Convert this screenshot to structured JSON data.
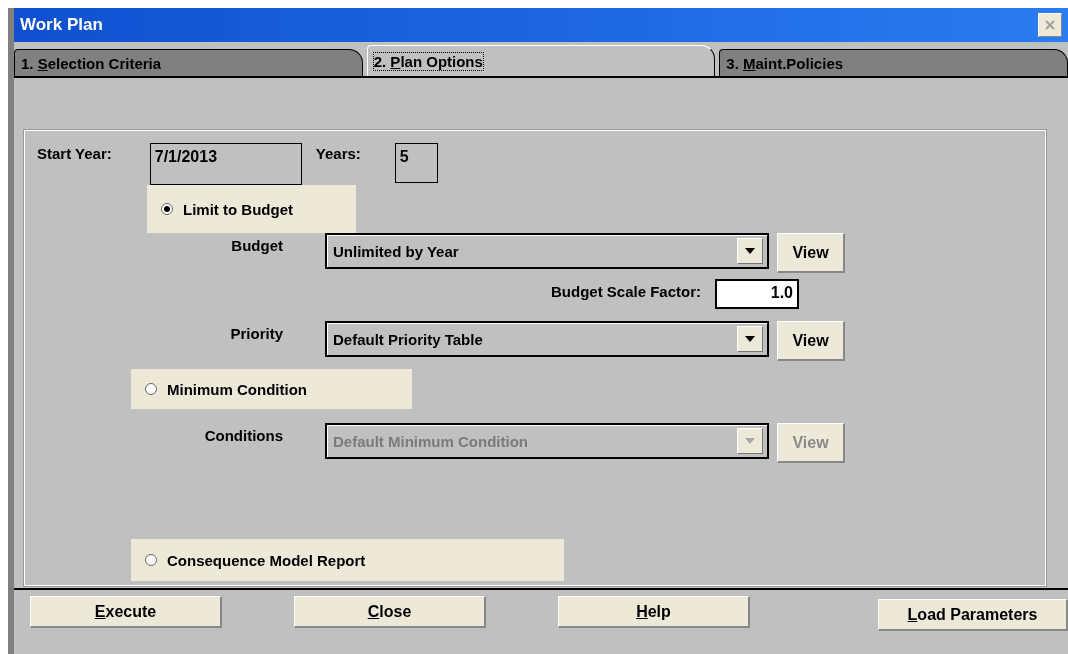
{
  "window": {
    "title": "Work Plan"
  },
  "tabs": [
    {
      "prefix": "1. ",
      "key": "S",
      "rest": "election Criteria",
      "selected": false
    },
    {
      "prefix": "2. ",
      "key": "P",
      "rest": "lan Options",
      "selected": true
    },
    {
      "prefix": "3. ",
      "key": "M",
      "rest": "aint.Policies",
      "selected": false
    }
  ],
  "start_year": {
    "label": "Start Year:",
    "value": "7/1/2013"
  },
  "years": {
    "label": "Years:",
    "value": "5"
  },
  "limit_to_budget": {
    "label": "Limit to Budget",
    "selected": true
  },
  "budget": {
    "label": "Budget",
    "value": "Unlimited by Year",
    "disabled": false,
    "button": "View"
  },
  "budget_scale_factor": {
    "label": "Budget Scale Factor:",
    "value": "1.0"
  },
  "priority": {
    "label": "Priority",
    "value": "Default Priority Table",
    "disabled": false,
    "button": "View"
  },
  "minimum_condition": {
    "label": "Minimum Condition",
    "selected": false
  },
  "conditions": {
    "label": "Conditions",
    "value": "Default Minimum Condition",
    "disabled": true,
    "button": "View"
  },
  "consequence_model_report": {
    "label": "Consequence Model Report",
    "selected": false
  },
  "buttons": [
    {
      "key": "E",
      "rest": "xecute",
      "kind": "action"
    },
    {
      "key": "C",
      "rest": "lose",
      "kind": "action"
    },
    {
      "key": "H",
      "rest": "elp",
      "kind": "action"
    },
    {
      "key": "L",
      "rest": "oad Parameters",
      "kind": "load"
    }
  ]
}
